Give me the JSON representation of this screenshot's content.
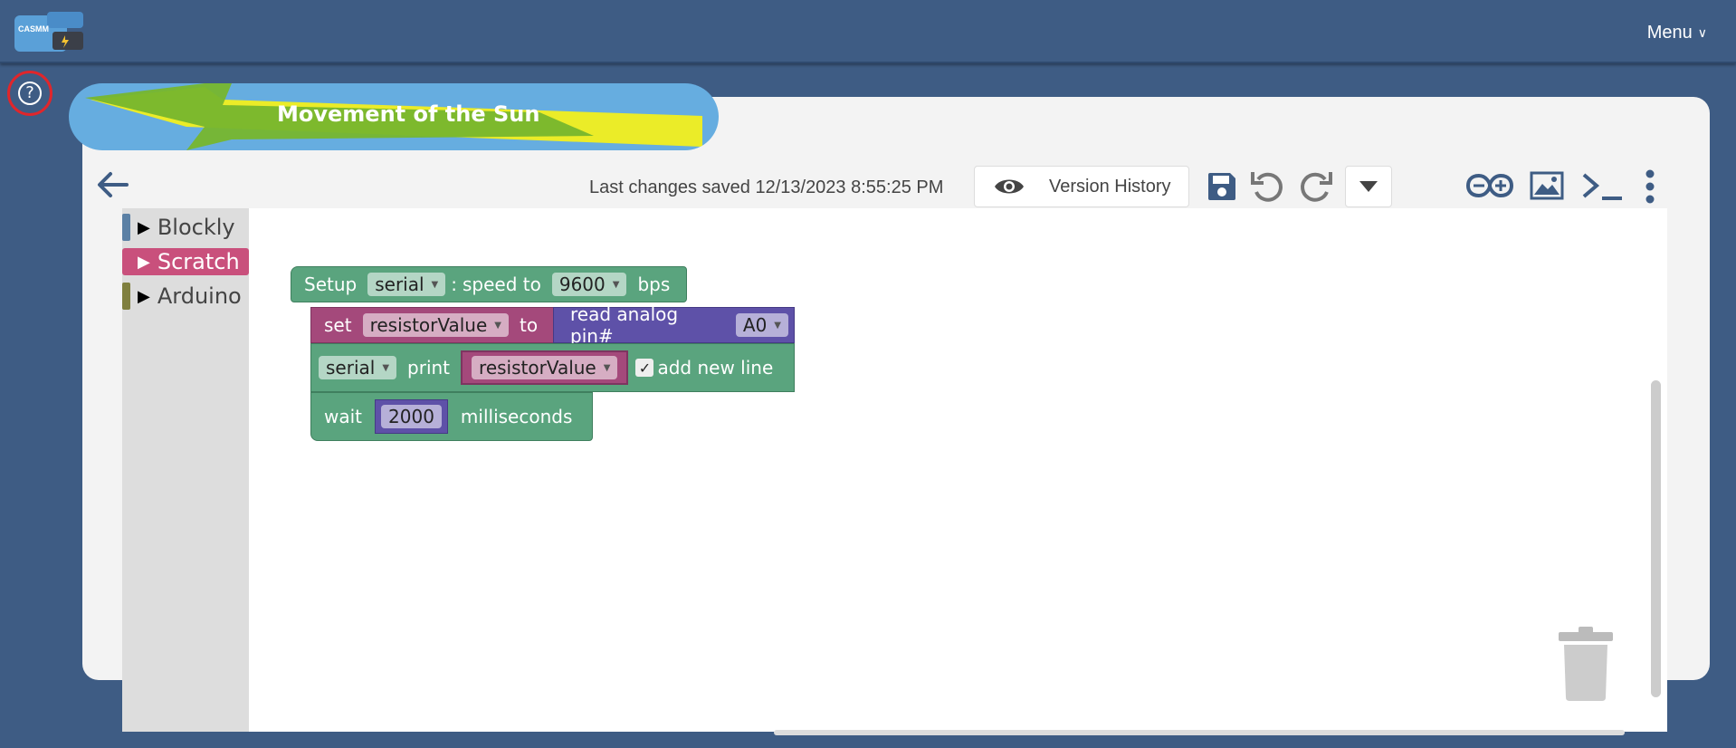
{
  "header": {
    "logo_text": "CASMM",
    "menu_label": "Menu"
  },
  "project": {
    "title": "Movement of the Sun"
  },
  "toolbar": {
    "saved_text": "Last changes saved 12/13/2023 8:55:25 PM",
    "version_history_label": "Version History",
    "icons": [
      "back-arrow-icon",
      "eye-icon",
      "save-icon",
      "undo-icon",
      "redo-icon",
      "caret-down-icon",
      "arduino-icon",
      "image-icon",
      "terminal-icon",
      "more-vert-icon"
    ]
  },
  "toolbox": {
    "categories": [
      {
        "label": "Blockly",
        "color": "#5b80a5"
      },
      {
        "label": "Scratch",
        "color": "#c9507c"
      },
      {
        "label": "Arduino",
        "color": "#7f7f3f"
      }
    ]
  },
  "blocks": {
    "setup": {
      "prefix": "Setup",
      "port": "serial",
      "colon": ":",
      "speed_label": "speed to",
      "speed": "9600",
      "unit": "bps"
    },
    "set_var": {
      "set_label": "set",
      "var": "resistorValue",
      "to_label": "to"
    },
    "read_pin": {
      "label": "read analog pin#",
      "pin": "A0"
    },
    "print": {
      "port": "serial",
      "label": "print",
      "var": "resistorValue",
      "check": "✓",
      "newline_label": "add new line"
    },
    "wait": {
      "label": "wait",
      "value": "2000",
      "unit": "milliseconds"
    }
  },
  "colors": {
    "header_bg": "#3e5c84",
    "title_pill": "#66ade0",
    "block_green": "#5aa47e",
    "block_magenta": "#a4497b",
    "block_purple": "#5e51a8"
  }
}
